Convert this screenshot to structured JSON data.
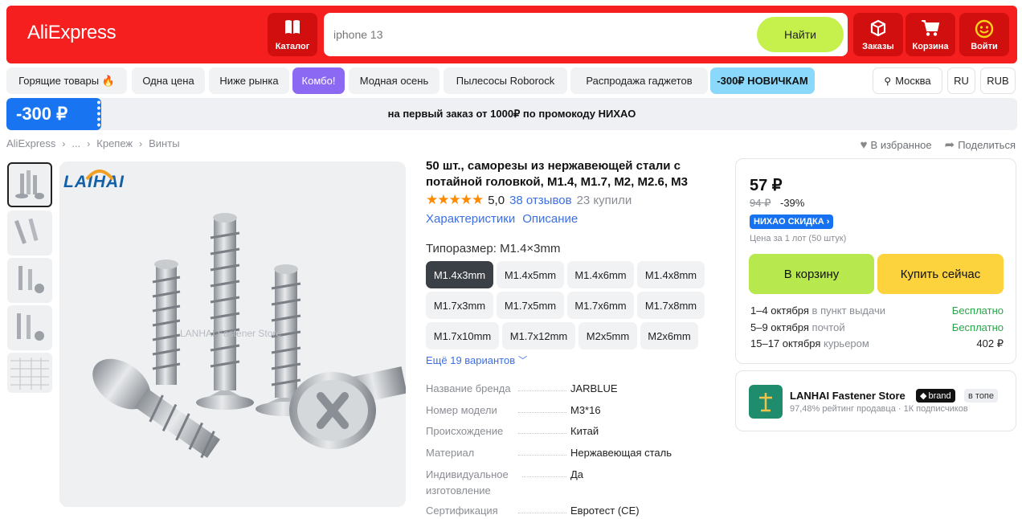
{
  "header": {
    "logo": "AliExpress",
    "catalog_label": "Каталог",
    "search": {
      "value": "iphone 13",
      "button": "Найти"
    },
    "orders_label": "Заказы",
    "cart_label": "Корзина",
    "login_label": "Войти"
  },
  "chips": {
    "hot": "Горящие товары 🔥",
    "one_price": "Одна цена",
    "below_market": "Ниже рынка",
    "combo": "Комбо!",
    "fashion": "Модная осень",
    "vacuums": "Пылесосы Roborock",
    "gadgets": "Распродажа гаджетов",
    "newbie": "-300₽ НОВИЧКАМ",
    "city": "Москва",
    "lang": "RU",
    "currency": "RUB"
  },
  "promo": {
    "tag": "-300 ₽",
    "text": "на первый заказ от 1000₽ по промокоду НИХАО"
  },
  "breadcrumb": [
    "AliExpress",
    "...",
    "Крепеж",
    "Винты"
  ],
  "page_actions": {
    "favorite": "В избранное",
    "share": "Поделиться"
  },
  "gallery": {
    "brand_logo": "LAIHAI",
    "watermark": "LANHAI Fastener Store"
  },
  "product": {
    "title": "50 шт., саморезы из нержавеющей стали с потайной головкой, M1.4, M1.7, M2, M2.6, M3",
    "stars": "★★★★★",
    "rating": "5,0",
    "reviews": "38 отзывов",
    "bought": "23 купили",
    "tabs": [
      "Характеристики",
      "Описание"
    ],
    "variant_label": "Типоразмер: M1.4×3mm",
    "variants": [
      "M1.4x3mm",
      "M1.4x5mm",
      "M1.4x6mm",
      "M1.4x8mm",
      "M1.7x3mm",
      "M1.7x5mm",
      "M1.7x6mm",
      "M1.7x8mm",
      "M1.7x10mm",
      "M1.7x12mm",
      "M2x5mm",
      "M2x6mm"
    ],
    "selected_variant": "M1.4x3mm",
    "more_variants": "Ещё 19 вариантов",
    "specs": [
      {
        "key": "Название бренда",
        "value": "JARBLUE"
      },
      {
        "key": "Номер модели",
        "value": "M3*16"
      },
      {
        "key": "Происхождение",
        "value": "Китай"
      },
      {
        "key": "Материал",
        "value": "Нержавеющая сталь"
      },
      {
        "key": "Индивидуальное изготовление",
        "value": "Да"
      },
      {
        "key": "Сертификация",
        "value": "Евротест (CE)"
      }
    ]
  },
  "buybox": {
    "price": "57 ₽",
    "old_price": "94 ₽",
    "discount": "-39%",
    "coupon": "НИХАО СКИДКА ›",
    "lot_note": "Цена за 1 лот (50 штук)",
    "cart_button": "В корзину",
    "buy_button": "Купить сейчас",
    "shipping": [
      {
        "date": "1–4 октября",
        "method": " в пункт выдачи",
        "price": "Бесплатно",
        "free": true
      },
      {
        "date": "5–9 октября",
        "method": " почтой",
        "price": "Бесплатно",
        "free": true
      },
      {
        "date": "15–17 октября",
        "method": " курьером",
        "price": "402 ₽",
        "free": false
      }
    ]
  },
  "store": {
    "name": "LANHAI Fastener Store",
    "brand_badge": "brand",
    "top_badge": "в топе",
    "meta": "97,48% рейтинг продавца · 1К подписчиков",
    "logo_color": "#1f8c6e"
  },
  "colors": {
    "brand_red": "#f51f1f",
    "search_green": "#c6f14d",
    "cart_green": "#b7e84e",
    "buy_yellow": "#fcd23d",
    "link_blue": "#3c6fe5",
    "combo_purple": "#8c69f2"
  }
}
